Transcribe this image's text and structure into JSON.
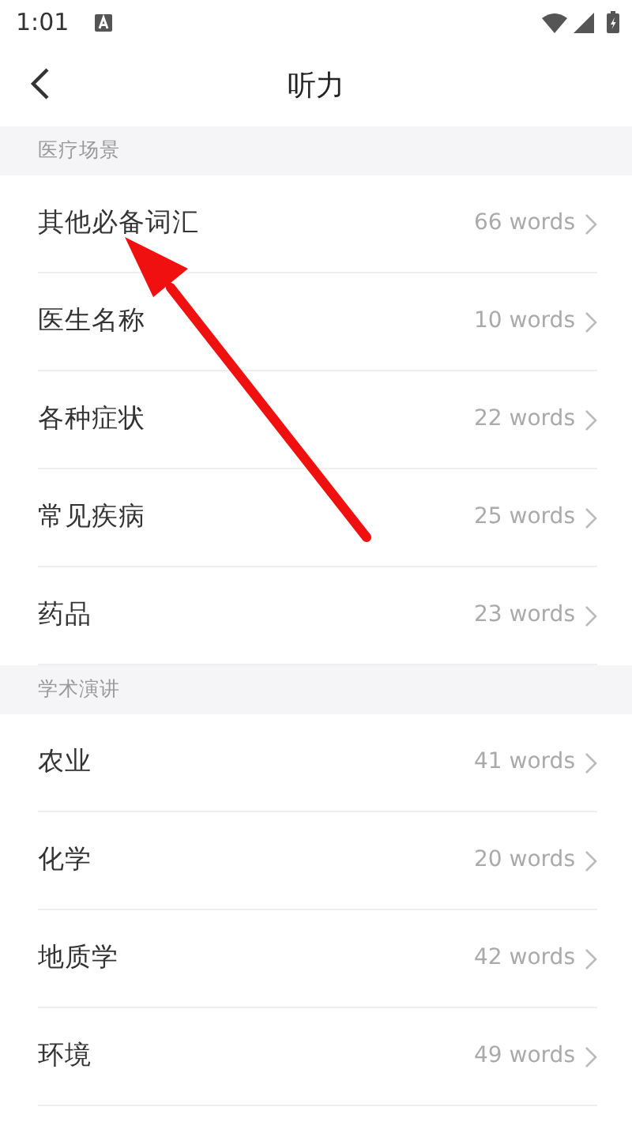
{
  "status_bar": {
    "time": "1:01"
  },
  "header": {
    "title": "听力"
  },
  "sections": [
    {
      "title": "医疗场景",
      "items": [
        {
          "name": "其他必备词汇",
          "count": "66 words"
        },
        {
          "name": "医生名称",
          "count": "10 words"
        },
        {
          "name": "各种症状",
          "count": "22 words"
        },
        {
          "name": "常见疾病",
          "count": "25 words"
        },
        {
          "name": "药品",
          "count": "23 words"
        }
      ]
    },
    {
      "title": "学术演讲",
      "items": [
        {
          "name": "农业",
          "count": "41 words"
        },
        {
          "name": "化学",
          "count": "20 words"
        },
        {
          "name": "地质学",
          "count": "42 words"
        },
        {
          "name": "环境",
          "count": "49 words"
        }
      ]
    }
  ]
}
